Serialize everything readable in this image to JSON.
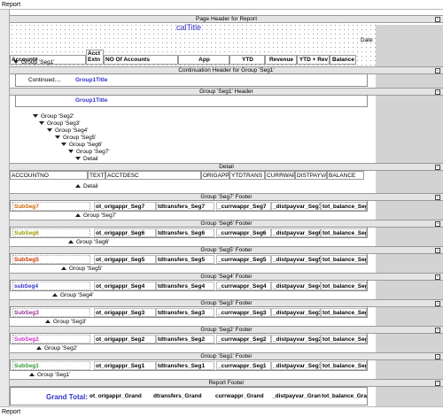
{
  "window": {
    "title": "Report",
    "footer": "Report"
  },
  "page_header": {
    "band_label": "Page Header for Report",
    "title_field": "calTitle",
    "date_label": "Date",
    "columns": [
      "Account#",
      "Acct Extn",
      "NO Of Accounts",
      "App",
      "YTD",
      "Revenue",
      "YTD + Rev",
      "Balance"
    ]
  },
  "groups_top": {
    "seg1_header": "Group 'Seg1'",
    "continuation": "Continuation Header for Group 'Seg1'",
    "continued_text": "Continued....",
    "group1_title": "Group1Title",
    "seg1_header_band": "Group 'Seg1' Header",
    "group1_title2": "Group1Title",
    "nested": [
      "Group 'Seg2'",
      "Group 'Seg3'",
      "Group 'Seg4'",
      "Group 'Seg5'",
      "Group 'Seg6'",
      "Group 'Seg7'",
      "Detail"
    ]
  },
  "detail": {
    "band_label": "Detail",
    "fields": [
      "ACCOUNTNO",
      "TEXT",
      "ACCTDESC",
      "ORIGAPPR",
      "YTDTRANS",
      "CURRWAPP",
      "DISTPAYVA",
      "BALANCE"
    ],
    "after": "Detail"
  },
  "footers": [
    {
      "band": "Group 'Seg7' Footer",
      "label": "SubSeg7",
      "color": "#cc6600",
      "f1": "ot_origappr_Seg7",
      "f2": "tdtransfers_Seg7",
      "f3": "_currwappr_Seg7",
      "f4": "_distpayvar_Seg7",
      "f5": "tot_balance_Seg7",
      "after": "Group 'Seg7'"
    },
    {
      "band": "Group 'Seg6' Footer",
      "label": "SubSeg6",
      "color": "#999900",
      "f1": "ot_origappr_Seg6",
      "f2": "tdtransfers_Seg6",
      "f3": "_currwappr_Seg6",
      "f4": "_distpayvar_Seg6",
      "f5": "tot_balance_Seg6",
      "after": "Group 'Seg6'"
    },
    {
      "band": "Group 'Seg5' Footer",
      "label": "SubSeg5",
      "color": "#cc3300",
      "f1": "ot_origappr_Seg5",
      "f2": "tdtransfers_Seg5",
      "f3": "_currwappr_Seg5",
      "f4": "_distpayvar_Seg5",
      "f5": "tot_balance_Seg5",
      "after": "Group 'Seg5'"
    },
    {
      "band": "Group 'Seg4' Footer",
      "label": "subSeg4",
      "color": "#3333cc",
      "f1": "ot_origappr_Seg4",
      "f2": "tdtransfers_Seg4",
      "f3": "_currwappr_Seg4",
      "f4": "_distpayvar_Seg4",
      "f5": "tot_balance_Seg4",
      "after": "Group 'Seg4'"
    },
    {
      "band": "Group 'Seg3' Footer",
      "label": "SubSeg3",
      "color": "#993399",
      "f1": "ot_origappr_Seg3",
      "f2": "tdtransfers_Seg3",
      "f3": "_currwappr_Seg3",
      "f4": "_distpayvar_Seg3",
      "f5": "tot_balance_Seg3",
      "after": "Group 'Seg3'"
    },
    {
      "band": "Group 'Seg2' Footer",
      "label": "SubSeg2",
      "color": "#cc33cc",
      "f1": "ot_origappr_Seg2",
      "f2": "tdtransfers_Seg2",
      "f3": "_currwappr_Seg2",
      "f4": "_distpayvar_Seg2",
      "f5": "tot_balance_Seg2",
      "after": "Group 'Seg2'"
    },
    {
      "band": "Group 'Seg1' Footer",
      "label": "SubSeg1",
      "color": "#339933",
      "f1": "ot_origappr_Seg1",
      "f2": "tdtransfers_Seg1",
      "f3": "_currwappr_Seg1",
      "f4": "_distpayvar_Seg1",
      "f5": "tot_balance_Seg1",
      "after": "Group 'Seg1'"
    }
  ],
  "report_footer": {
    "band": "Report Footer",
    "label": "Grand Total:",
    "f1": "ot_origappr_Grand",
    "f2": "dtransfers_Grand",
    "f3": "currwappr_Grand",
    "f4": "_distpayvar_Grand",
    "f5": "tot_balance_Grand"
  },
  "colors": {
    "band": "#e4e4e4",
    "grey_zone": "#d3d3d3",
    "title_blue": "#3333cc"
  }
}
